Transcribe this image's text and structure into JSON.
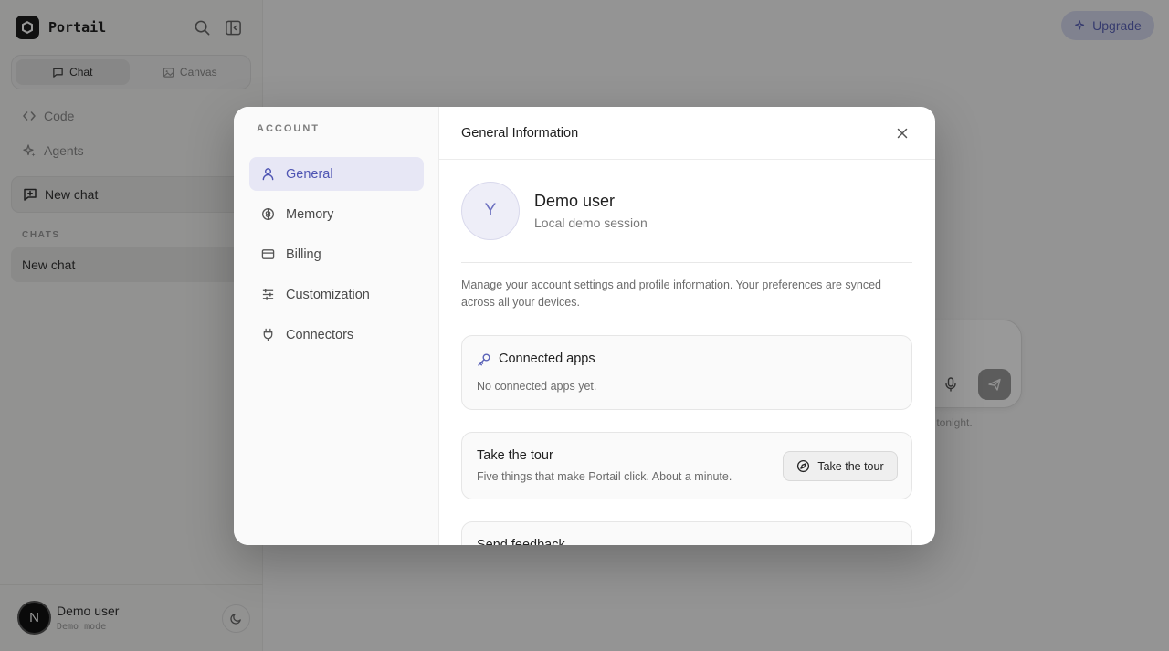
{
  "app": {
    "name": "Portail",
    "upgrade_label": "Upgrade",
    "modes": [
      {
        "label": "Chat",
        "active": true
      },
      {
        "label": "Canvas",
        "active": false
      }
    ],
    "nav": [
      {
        "label": "Code",
        "icon": "code-icon"
      },
      {
        "label": "Agents",
        "icon": "sparkle-icon"
      }
    ],
    "new_chat_label": "New chat",
    "chats_section_label": "CHATS",
    "chats": [
      {
        "title": "New chat"
      }
    ],
    "user": {
      "initial": "N",
      "name": "Demo user",
      "mode": "Demo mode"
    },
    "composer_hint": "r tonight."
  },
  "modal": {
    "section_label": "ACCOUNT",
    "nav_items": [
      {
        "label": "General",
        "icon": "person-icon",
        "active": true
      },
      {
        "label": "Memory",
        "icon": "brain-icon",
        "active": false
      },
      {
        "label": "Billing",
        "icon": "credit-card-icon",
        "active": false
      },
      {
        "label": "Customization",
        "icon": "sliders-icon",
        "active": false
      },
      {
        "label": "Connectors",
        "icon": "plug-icon",
        "active": false
      }
    ],
    "title": "General Information",
    "profile": {
      "initial": "Y",
      "name": "Demo user",
      "subtitle": "Local demo session"
    },
    "description": "Manage your account settings and profile information. Your preferences are synced across all your devices.",
    "connected_apps": {
      "title": "Connected apps",
      "empty_text": "No connected apps yet."
    },
    "tour": {
      "title": "Take the tour",
      "subtitle": "Five things that make Portail click. About a minute.",
      "button_label": "Take the tour"
    },
    "feedback": {
      "title": "Send feedback"
    }
  },
  "colors": {
    "accent": "#4f55b3",
    "accent_bg": "#e7e7f5",
    "overlay": "rgba(0,0,0,0.40)"
  }
}
